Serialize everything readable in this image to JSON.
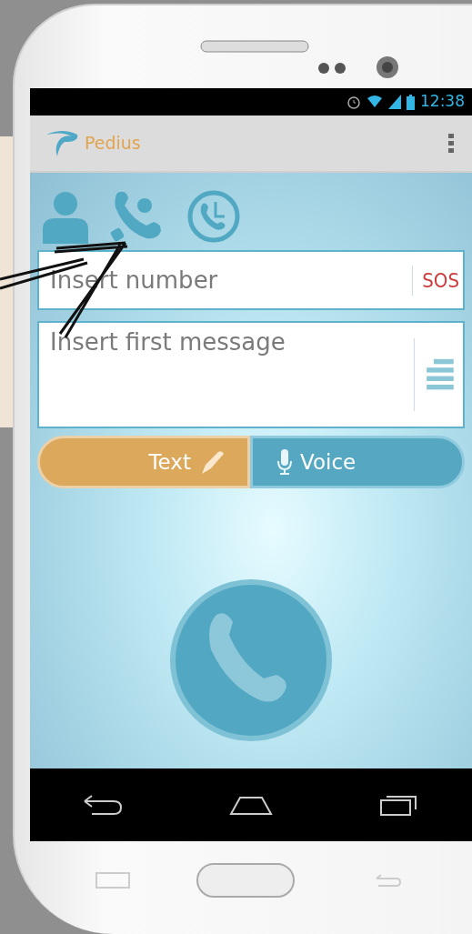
{
  "status_bar": {
    "time": "12:38"
  },
  "app_bar": {
    "title": "Pedius"
  },
  "number_field": {
    "placeholder": "Insert number",
    "sos": "SOS"
  },
  "message_field": {
    "placeholder": "Insert first message"
  },
  "modes": [
    {
      "kind": "text",
      "label": "Text",
      "selected": true
    },
    {
      "kind": "voice",
      "label": "Voice",
      "selected": false
    }
  ]
}
